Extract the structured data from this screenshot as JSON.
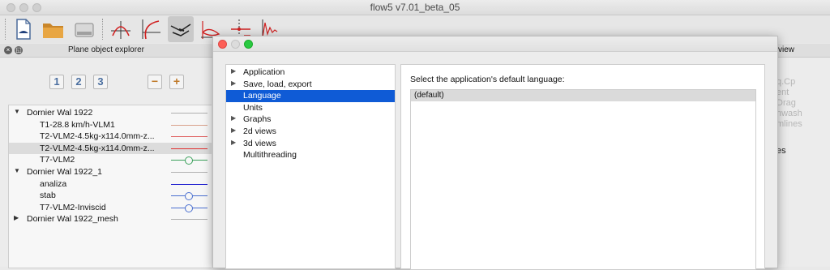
{
  "window": {
    "title": "flow5 v7.01_beta_05"
  },
  "toolbar": {
    "buttons": [
      {
        "icon": "new-project-icon"
      },
      {
        "icon": "open-folder-icon"
      },
      {
        "icon": "save-drive-icon"
      },
      {
        "icon": "foil-analysis-icon"
      },
      {
        "icon": "polar-analysis-icon"
      },
      {
        "icon": "plane-analysis-icon"
      },
      {
        "icon": "foil-design-icon"
      },
      {
        "icon": "inverse-design-icon"
      },
      {
        "icon": "xfoil-direct-icon"
      }
    ]
  },
  "explorer": {
    "title": "Plane object explorer",
    "view_buttons": [
      "1",
      "2",
      "3"
    ],
    "minus": "−",
    "plus": "+",
    "rows": [
      {
        "label": "Dornier Wal 1922",
        "arrow": "▼",
        "indent": 0,
        "color": "#b0b0b0",
        "dot": false,
        "selected": false
      },
      {
        "label": "T1-28.8 km/h-VLM1",
        "arrow": "",
        "indent": 1,
        "color": "#d9a08a",
        "dot": false,
        "selected": false
      },
      {
        "label": "T2-VLM2-4.5kg-x114.0mm-z...",
        "arrow": "",
        "indent": 1,
        "color": "#e06060",
        "dot": false,
        "selected": false
      },
      {
        "label": "T2-VLM2-4.5kg-x114.0mm-z...",
        "arrow": "",
        "indent": 1,
        "color": "#e03030",
        "dot": false,
        "selected": true
      },
      {
        "label": "T7-VLM2",
        "arrow": "",
        "indent": 1,
        "color": "#3aa05a",
        "dot": true,
        "selected": false
      },
      {
        "label": "Dornier Wal 1922_1",
        "arrow": "▼",
        "indent": 0,
        "color": "#b0b0b0",
        "dot": false,
        "selected": false
      },
      {
        "label": "analiza",
        "arrow": "",
        "indent": 1,
        "color": "#2020d0",
        "dot": false,
        "selected": false
      },
      {
        "label": "stab",
        "arrow": "",
        "indent": 1,
        "color": "#4a6fd0",
        "dot": true,
        "selected": false
      },
      {
        "label": "T7-VLM2-Inviscid",
        "arrow": "",
        "indent": 1,
        "color": "#4a6fd0",
        "dot": true,
        "selected": false
      },
      {
        "label": "Dornier Wal 1922_mesh",
        "arrow": "▶",
        "indent": 0,
        "color": "#b0b0b0",
        "dot": false,
        "selected": false
      }
    ]
  },
  "right_dock": {
    "title": "view",
    "items_faded": [
      "q.Cp",
      "ent",
      "Drag",
      "nwash",
      "mlines"
    ],
    "item_dark": "es"
  },
  "preferences": {
    "categories": [
      {
        "label": "Application",
        "arrow": "▶",
        "selected": false
      },
      {
        "label": "Save, load, export",
        "arrow": "▶",
        "selected": false
      },
      {
        "label": "Language",
        "arrow": "",
        "selected": true
      },
      {
        "label": "Units",
        "arrow": "",
        "selected": false
      },
      {
        "label": "Graphs",
        "arrow": "▶",
        "selected": false
      },
      {
        "label": "2d views",
        "arrow": "▶",
        "selected": false
      },
      {
        "label": "3d views",
        "arrow": "▶",
        "selected": false
      },
      {
        "label": "Multithreading",
        "arrow": "",
        "selected": false
      }
    ],
    "language_prompt": "Select the application's default language:",
    "languages": [
      "(default)"
    ],
    "selected_language": "(default)"
  }
}
